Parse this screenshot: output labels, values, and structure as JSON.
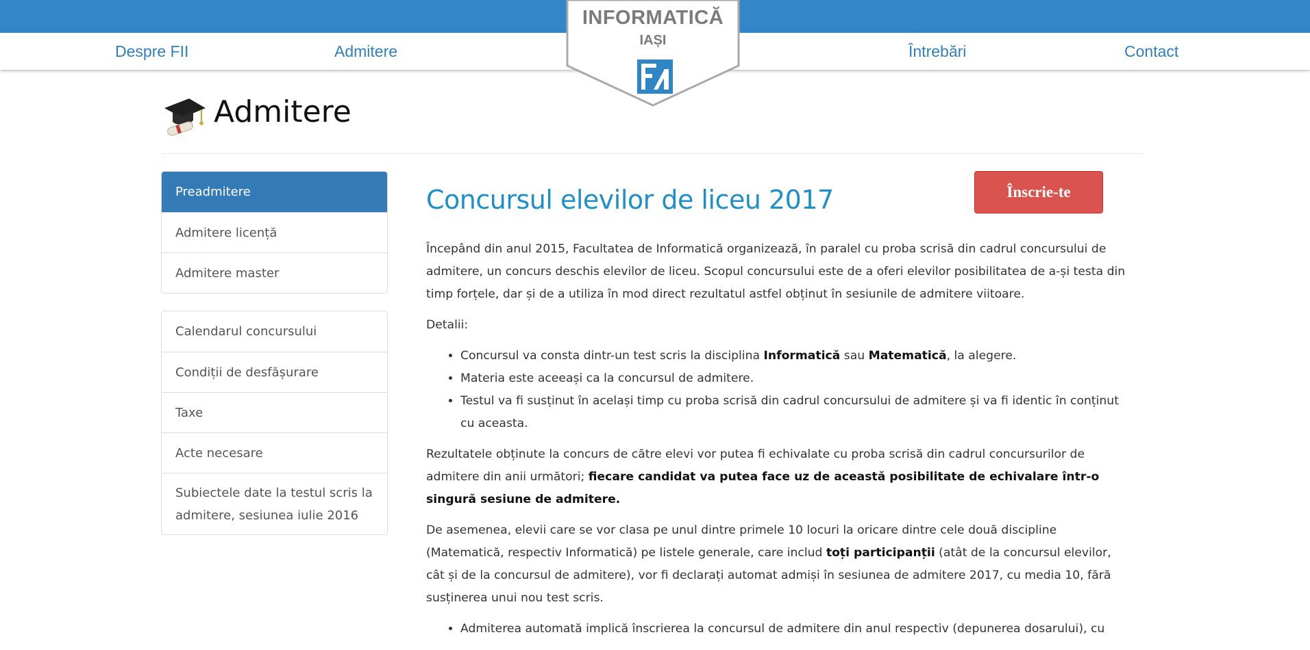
{
  "nav": {
    "items": [
      {
        "label": "Despre FII"
      },
      {
        "label": "Admitere"
      },
      {
        "label": "Întrebări"
      },
      {
        "label": "Contact"
      }
    ]
  },
  "logo": {
    "title": "INFORMATICĂ",
    "subtitle": "IAȘI",
    "brand_color": "#3386c8"
  },
  "page": {
    "title": "Admitere",
    "icon": "graduation-cap-icon"
  },
  "sidebar": {
    "group1": [
      {
        "label": "Preadmitere",
        "active": true
      },
      {
        "label": "Admitere licență"
      },
      {
        "label": "Admitere master"
      }
    ],
    "group2": [
      {
        "label": "Calendarul concursului"
      },
      {
        "label": "Condiții de desfășurare"
      },
      {
        "label": "Taxe"
      },
      {
        "label": "Acte necesare"
      },
      {
        "label": "Subiectele date la testul scris la admitere, sesiunea iulie 2016"
      }
    ]
  },
  "content": {
    "title": "Concursul elevilor de liceu 2017",
    "signup_label": "Înscrie-te",
    "signup_color": "#d9534f",
    "p1": "Începând din anul 2015, Facultatea de Informatică organizează, în paralel cu proba scrisă din cadrul concursului de admitere, un concurs deschis elevilor de liceu. Scopul concursului este de a oferi elevilor posibilitatea de a-și testa din timp forțele, dar și de a utiliza în mod direct rezultatul astfel obținut în sesiunile de admitere viitoare.",
    "details_label": "Detalii:",
    "bullet1_a": "Concursul va consta dintr-un test scris la disciplina ",
    "bullet1_b1": "Informatică",
    "bullet1_c": " sau ",
    "bullet1_b2": "Matematică",
    "bullet1_d": ", la alegere.",
    "bullet2": "Materia este aceeași ca la concursul de admitere.",
    "bullet3": "Testul va fi susținut în același timp cu proba scrisă din cadrul concursului de admitere și va fi identic în conținut cu aceasta.",
    "p2_a": "Rezultatele obținute la concurs de către elevi vor putea fi echivalate cu proba scrisă din cadrul concursurilor de admitere din anii următori; ",
    "p2_b": "fiecare candidat va putea face uz de această posibilitate de echivalare într-o singură sesiune de admitere.",
    "p3_a": "De asemenea, elevii care se vor clasa pe unul dintre primele 10 locuri la oricare dintre cele două discipline (Matematică, respectiv Informatică) pe listele generale, care includ ",
    "p3_b": "toți participanții",
    "p3_c": " (atât de la concursul elevilor, cât și de la concursul de admitere), vor fi declarați automat admiși în sesiunea de admitere 2017, cu media 10, fără susținerea unui nou test scris.",
    "bullet4": "Admiterea automată implică înscrierea la concursul de admitere din anul respectiv (depunerea dosarului), cu"
  }
}
